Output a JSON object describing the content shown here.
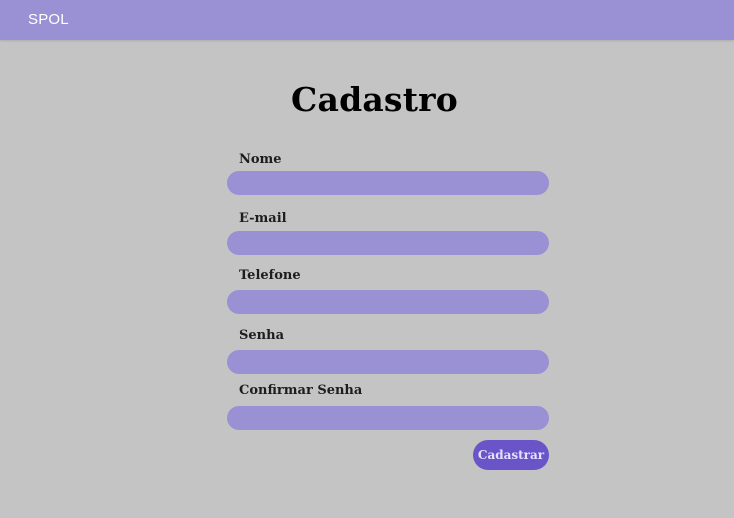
{
  "header": {
    "brand": "SPOL"
  },
  "page": {
    "title": "Cadastro"
  },
  "form": {
    "fields": [
      {
        "label": "Nome",
        "value": "",
        "placeholder": ""
      },
      {
        "label": "E-mail",
        "value": "",
        "placeholder": ""
      },
      {
        "label": "Telefone",
        "value": "",
        "placeholder": ""
      },
      {
        "label": "Senha",
        "value": "",
        "placeholder": ""
      },
      {
        "label": "Confirmar Senha",
        "value": "",
        "placeholder": ""
      }
    ],
    "submit_label": "Cadastrar"
  },
  "colors": {
    "background": "#c4c4c4",
    "header": "#9a90d4",
    "input": "#9a90d4",
    "button": "#6a55c8"
  }
}
